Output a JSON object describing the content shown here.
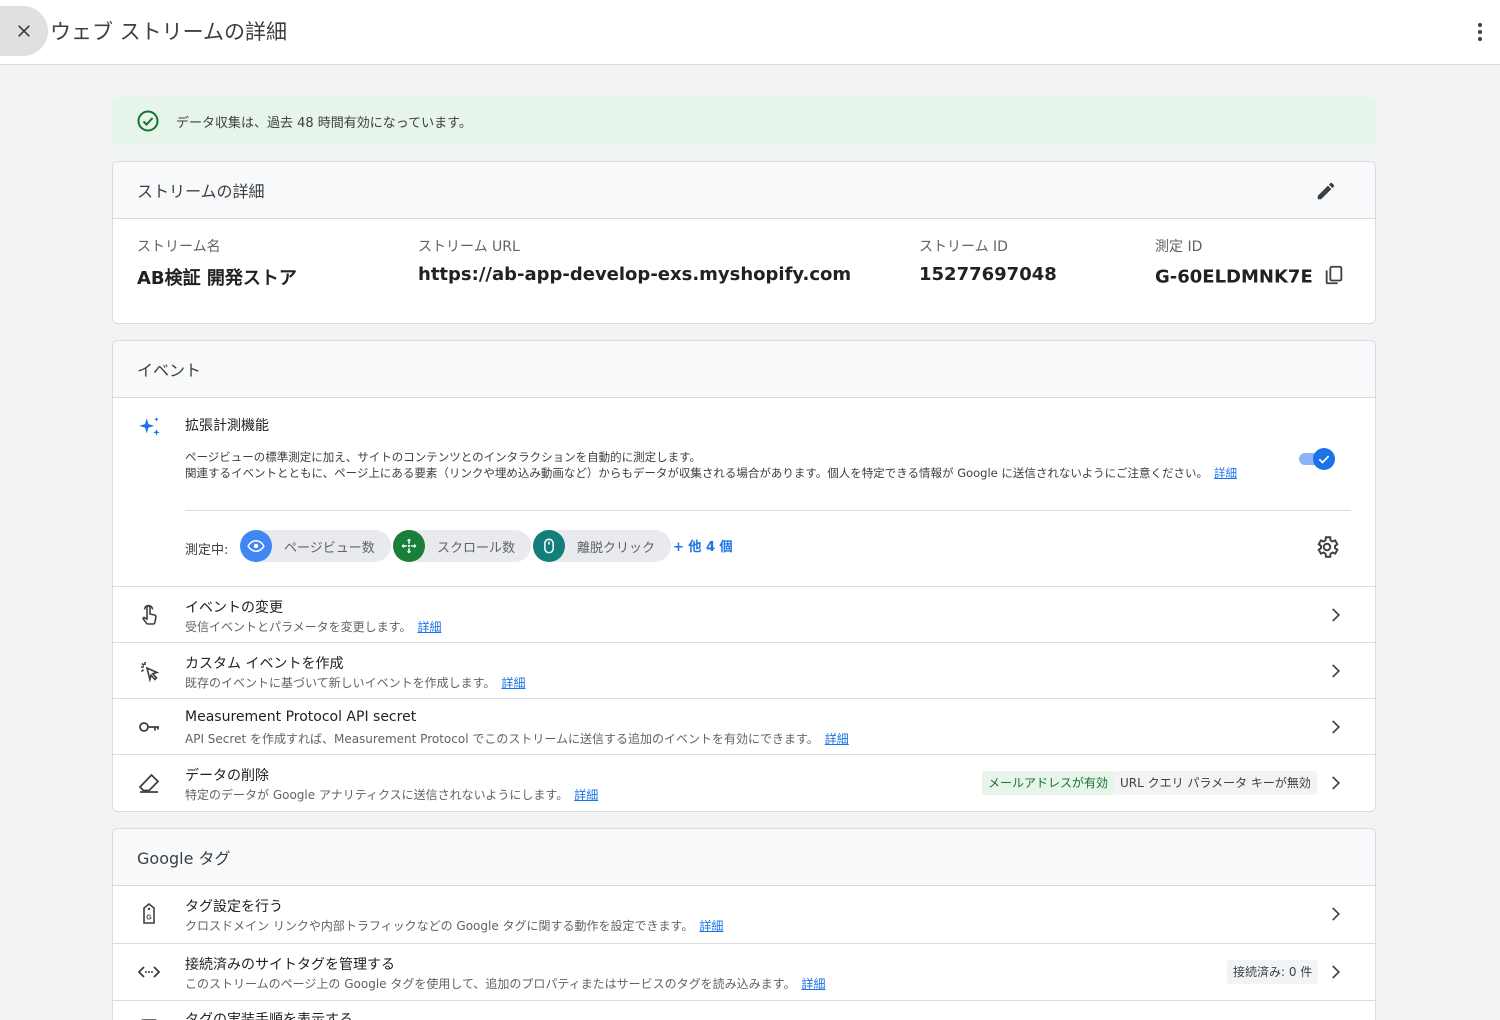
{
  "header": {
    "title": "ウェブ ストリームの詳細"
  },
  "banner": {
    "text": "データ収集は、過去 48 時間有効になっています。"
  },
  "stream_details": {
    "heading": "ストリームの詳細",
    "name_label": "ストリーム名",
    "name_value": "AB検証 開発ストア",
    "url_label": "ストリーム URL",
    "url_value": "https://ab-app-develop-exs.myshopify.com",
    "id_label": "ストリーム ID",
    "id_value": "15277697048",
    "mid_label": "測定 ID",
    "mid_value": "G-60ELDMNK7E"
  },
  "events": {
    "heading": "イベント",
    "enhanced": {
      "title": "拡張計測機能",
      "desc1": "ページビューの標準測定に加え、サイトのコンテンツとのインタラクションを自動的に測定します。",
      "desc2": "関連するイベントとともに、ページ上にある要素（リンクや埋め込み動画など）からもデータが収集される場合があります。個人を特定できる情報が Google に送信されないようにご注意ください。",
      "link": "詳細",
      "measuring_label": "測定中:",
      "chips": [
        "ページビュー数",
        "スクロール数",
        "離脱クリック"
      ],
      "more": "+ 他 4 個",
      "toggle_on": true
    },
    "rows": [
      {
        "title": "イベントの変更",
        "desc": "受信イベントとパラメータを変更します。",
        "link": "詳細"
      },
      {
        "title": "カスタム イベントを作成",
        "desc": "既存のイベントに基づいて新しいイベントを作成します。",
        "link": "詳細"
      },
      {
        "title": "Measurement Protocol API secret",
        "desc": "API Secret を作成すれば、Measurement Protocol でこのストリームに送信する追加のイベントを有効にできます。",
        "link": "詳細"
      },
      {
        "title": "データの削除",
        "desc": "特定のデータが Google アナリティクスに送信されないようにします。",
        "link": "詳細",
        "tag1": "メールアドレスが有効",
        "tag2": "URL クエリ パラメータ キーが無効"
      }
    ]
  },
  "google_tag": {
    "heading": "Google タグ",
    "rows": [
      {
        "title": "タグ設定を行う",
        "desc": "クロスドメイン リンクや内部トラフィックなどの Google タグに関する動作を設定できます。",
        "link": "詳細"
      },
      {
        "title": "接続済みのサイトタグを管理する",
        "desc": "このストリームのページ上の Google タグを使用して、追加のプロパティまたはサービスのタグを読み込みます。",
        "link": "詳細",
        "tag": "接続済み: 0 件"
      },
      {
        "title": "タグの実装手順を表示する"
      }
    ]
  },
  "colors": {
    "accent": "#1a73e8",
    "success": "#137333",
    "chip_blue": "#4285f4",
    "chip_green": "#188038",
    "chip_teal": "#137f7a"
  }
}
